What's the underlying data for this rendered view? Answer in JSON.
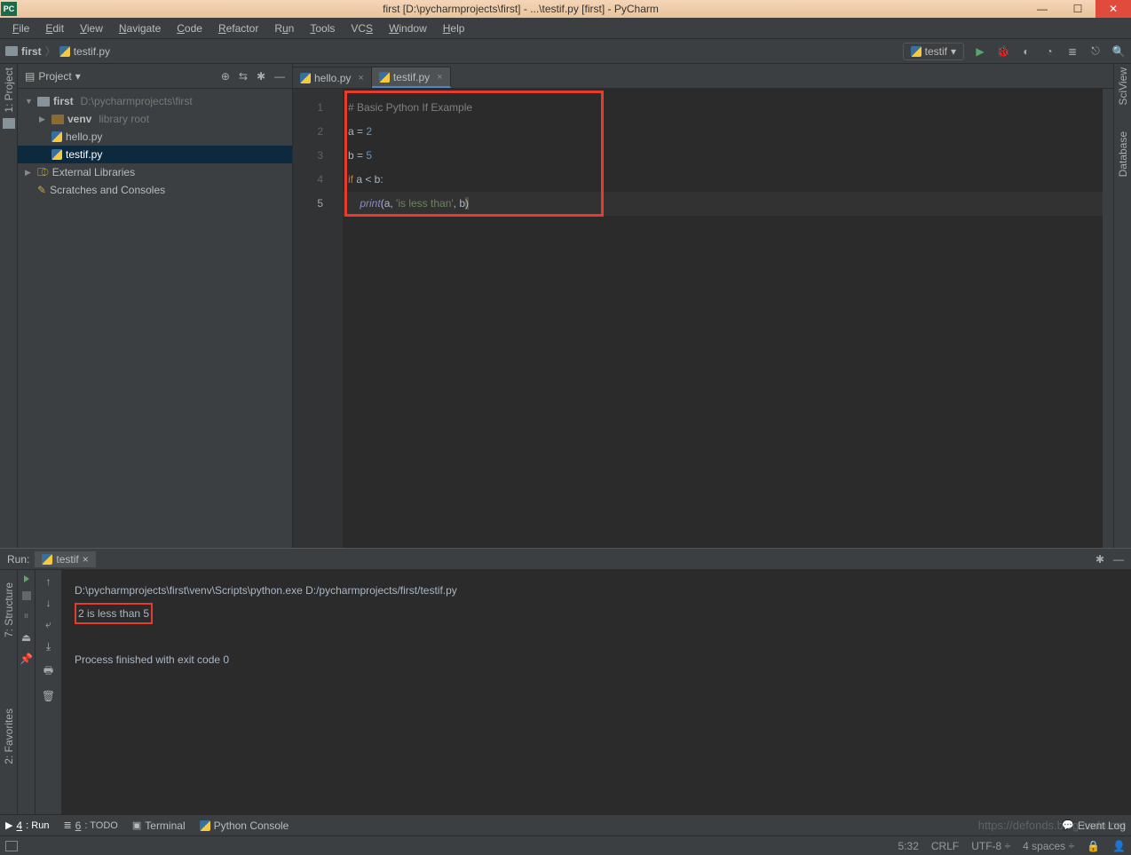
{
  "title": "first [D:\\pycharmprojects\\first] - ...\\testif.py [first] - PyCharm",
  "menus": {
    "file": "File",
    "edit": "Edit",
    "view": "View",
    "navigate": "Navigate",
    "code": "Code",
    "refactor": "Refactor",
    "run": "Run",
    "tools": "Tools",
    "vcs": "VCS",
    "window": "Window",
    "help": "Help"
  },
  "breadcrumb": {
    "root": "first",
    "file": "testif.py"
  },
  "run_config": "testif",
  "project_panel": {
    "label": "Project",
    "tree": {
      "root_name": "first",
      "root_path": "D:\\pycharmprojects\\first",
      "venv": "venv",
      "venv_note": "library root",
      "files": [
        "hello.py",
        "testif.py"
      ],
      "ext_libs": "External Libraries",
      "scratches": "Scratches and Consoles"
    }
  },
  "tabs": [
    {
      "name": "hello.py",
      "active": false
    },
    {
      "name": "testif.py",
      "active": true
    }
  ],
  "code_lines": [
    "1",
    "2",
    "3",
    "4",
    "5"
  ],
  "code": {
    "l1": "# Basic Python If Example",
    "l2a": "a = ",
    "l2b": "2",
    "l3a": "b = ",
    "l3b": "5",
    "l4a": "if",
    "l4b": " a < b:",
    "l5indent": "    ",
    "l5a": "print",
    "l5p1": "(",
    "l5arg1": "a",
    "l5c1": ", ",
    "l5str": "'is less than'",
    "l5c2": ", ",
    "l5arg2": "b",
    "l5p2": ")"
  },
  "right_tabs": {
    "sci": "SciView",
    "db": "Database"
  },
  "left_tabs": {
    "project": "1: Project",
    "structure": "7: Structure",
    "favorites": "2: Favorites"
  },
  "run_panel": {
    "label": "Run:",
    "tab": "testif",
    "cmd": "D:\\pycharmprojects\\first\\venv\\Scripts\\python.exe D:/pycharmprojects/first/testif.py",
    "output": "2 is less than 5",
    "exit": "Process finished with exit code 0"
  },
  "bottom_tabs": {
    "run": "4: Run",
    "todo": "6: TODO",
    "terminal": "Terminal",
    "pyconsole": "Python Console",
    "eventlog": "Event Log"
  },
  "status": {
    "pos": "5:32",
    "crlf": "CRLF",
    "enc": "UTF-8",
    "indent": "4 spaces",
    "git": "⎇"
  },
  "watermark": "https://defonds.blog.csdn.net"
}
